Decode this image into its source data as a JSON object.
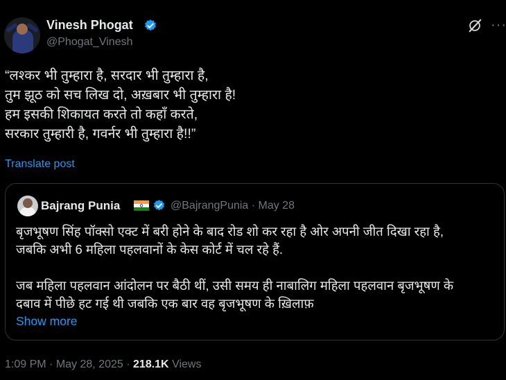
{
  "author": {
    "name": "Vinesh Phogat",
    "handle": "@Phogat_Vinesh",
    "verified_icon": "verified-badge-icon"
  },
  "actions": {
    "grok_icon": "grok-slash-icon",
    "more_icon": "ellipsis-icon",
    "more_label": "···"
  },
  "tweet": {
    "text": "“लश्कर भी तुम्हारा है, सरदार भी तुम्हारा है,\nतुम झूठ को सच लिख दो, अख़बार भी तुम्हारा है!\nहम इसकी शिकायत करते तो कहाँ करते,\nसरकार तुम्हारी है, गवर्नर भी तुम्हारा है!!”",
    "translate_label": "Translate post"
  },
  "quoted": {
    "name": "Bajrang Punia",
    "flag_icon": "india-flag-icon",
    "handle": "@BajrangPunia",
    "separator": "·",
    "date": "May 28",
    "text": "बृजभूषण सिंह पॉक्सो एक्ट में बरी होने के बाद रोड शो कर रहा है ओर अपनी जीत दिखा रहा है,\nजबकि अभी 6 महिला पहलवानों के केस कोर्ट में चल रहे हैं.\n\nजब महिला पहलवान आंदोलन पर बैठी थीं, उसी समय ही नाबालिग महिला पहलवान बृजभूषण के\nदबाव में पीछे हट गई थी जबकि एक बार वह बृजभूषण के ख़िलाफ़",
    "show_more": "Show more"
  },
  "footer": {
    "time": "1:09 PM",
    "dot1": "·",
    "date": "May 28, 2025",
    "dot2": "·",
    "views_count": "218.1K",
    "views_label": "Views"
  },
  "colors": {
    "background": "#000000",
    "text": "#e7e9ea",
    "secondary": "#71767b",
    "accent": "#1d9bf0",
    "border": "#2f3336"
  }
}
